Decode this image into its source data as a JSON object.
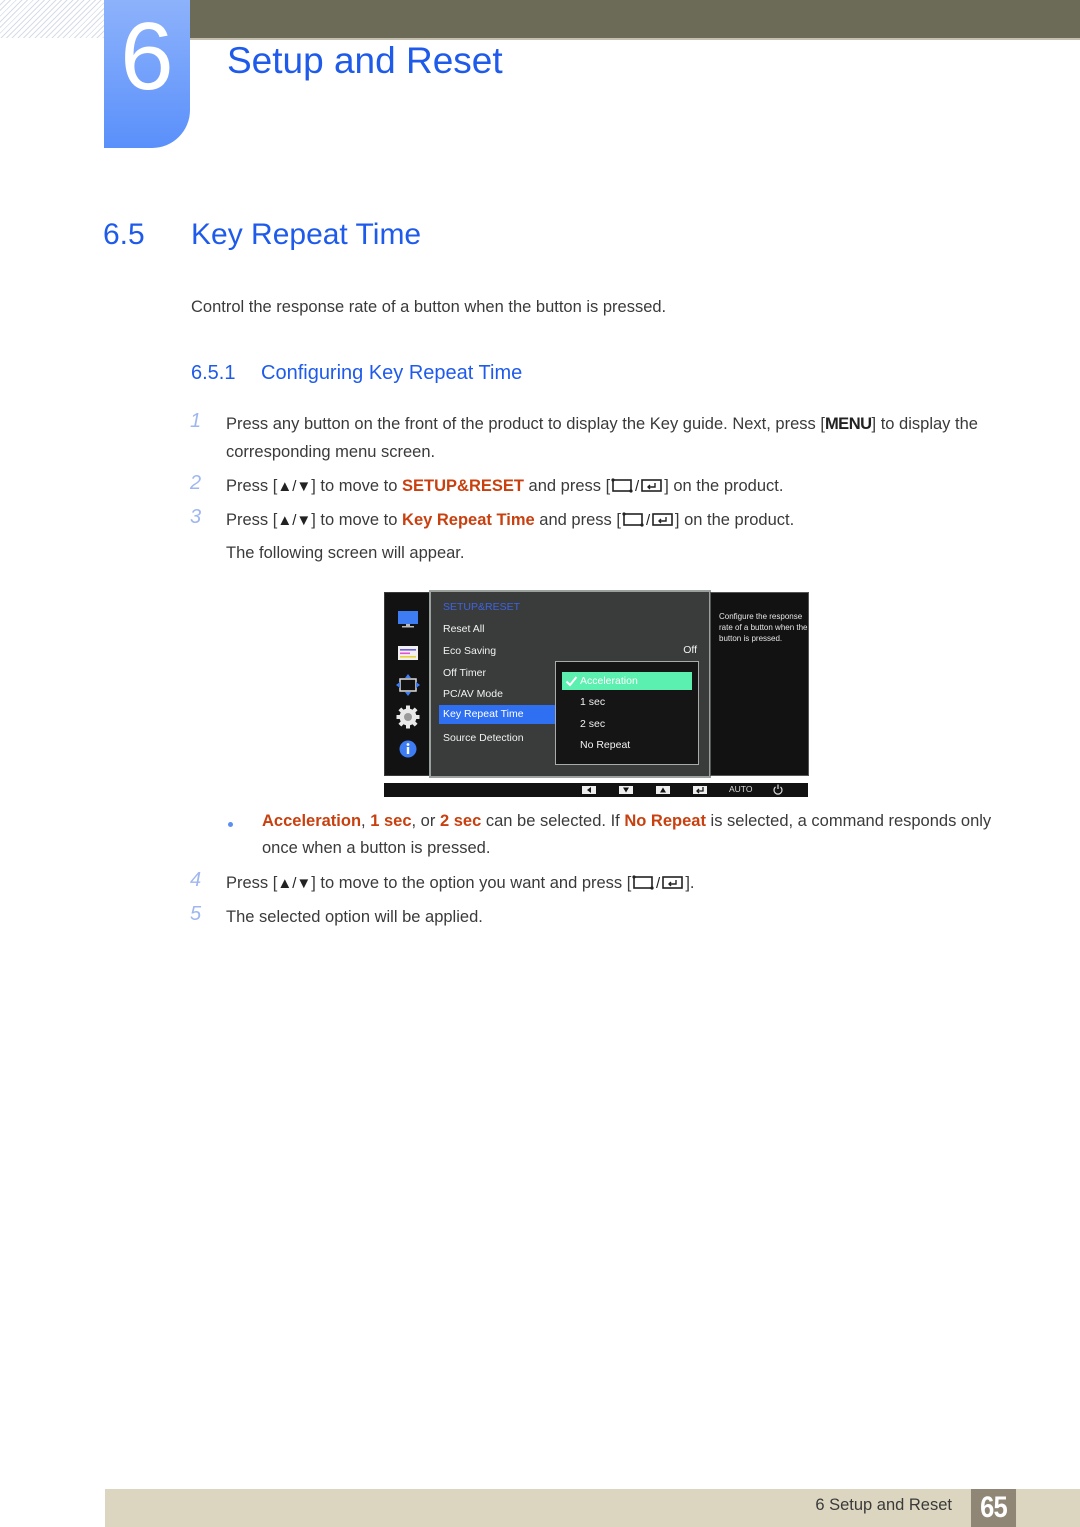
{
  "header": {
    "chapter_number": "6",
    "chapter_title": "Setup and Reset"
  },
  "section": {
    "number": "6.5",
    "title": "Key Repeat Time",
    "intro": "Control the response rate of a button when the button is pressed."
  },
  "subsection": {
    "number": "6.5.1",
    "title": "Configuring Key Repeat Time"
  },
  "steps": [
    {
      "num": "1",
      "parts": {
        "a": "Press any button on the front of the product to display the Key guide. Next, press [",
        "key": "MENU",
        "b": "] to display the corresponding menu screen."
      }
    },
    {
      "num": "2",
      "parts": {
        "a": "Press [",
        "updown": "▲/▼",
        "b": "] to move to ",
        "highlight": "SETUP&RESET",
        "c": " and press [",
        "d": "] on the product."
      }
    },
    {
      "num": "3",
      "parts": {
        "a": "Press [",
        "updown": "▲/▼",
        "b": "] to move to ",
        "highlight": "Key Repeat Time",
        "c": " and press [",
        "d": "] on the product.",
        "followup": "The following screen will appear."
      }
    },
    {
      "num": "4",
      "parts": {
        "a": "Press [",
        "updown": "▲/▼",
        "b": "] to move to the option you want and press [",
        "c": "]."
      }
    },
    {
      "num": "5",
      "parts": {
        "a": "The selected option will be applied."
      }
    }
  ],
  "osd": {
    "side_icons": [
      "monitor-icon",
      "picture-settings-icon",
      "position-icon",
      "setup-gear-icon",
      "info-icon"
    ],
    "section_label": "SETUP&RESET",
    "menu_items": [
      "Reset All",
      "Eco Saving",
      "Off Timer",
      "PC/AV Mode",
      "Key Repeat Time",
      "Source Detection"
    ],
    "selected_item": "Key Repeat Time",
    "eco_saving_value": "Off",
    "options": [
      "Acceleration",
      "1 sec",
      "2 sec",
      "No Repeat"
    ],
    "selected_option": "Acceleration",
    "help_text": "Configure the response rate of a button when the button is pressed.",
    "bottom_bar": {
      "buttons": [
        "left-arrow-icon",
        "down-arrow-icon",
        "up-arrow-icon",
        "enter-icon"
      ],
      "auto_label": "AUTO",
      "power": "power-icon"
    },
    "colors": {
      "section_label": "#3f63e0",
      "selected_item_bg": "#2f6ff2",
      "selected_option_bg": "#5cf0b0"
    }
  },
  "note": {
    "hl1": "Acceleration",
    "sep1": ", ",
    "hl2": "1 sec",
    "sep2": ", or ",
    "hl3": "2 sec",
    "mid": " can be selected. If ",
    "hl4": "No Repeat",
    "end": " is selected, a command responds only once when a button is pressed."
  },
  "footer": {
    "label": "6 Setup and Reset",
    "page": "65"
  },
  "colors": {
    "heading_blue": "#1f5bea",
    "highlight_orange": "#c8400f",
    "top_bar": "#6c6b58",
    "footer_bg": "#dcd6c0",
    "page_box": "#8f8676"
  }
}
